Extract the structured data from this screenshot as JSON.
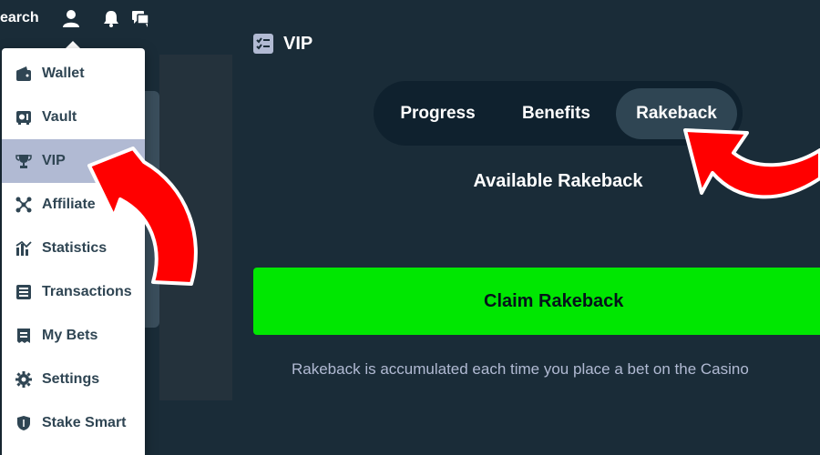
{
  "topbar": {
    "search_label": "earch",
    "icons": [
      "user-icon",
      "bell-icon",
      "chat-icon"
    ]
  },
  "menu": {
    "items": [
      {
        "label": "Wallet",
        "icon": "wallet-icon",
        "active": false
      },
      {
        "label": "Vault",
        "icon": "vault-icon",
        "active": false
      },
      {
        "label": "VIP",
        "icon": "trophy-icon",
        "active": true
      },
      {
        "label": "Affiliate",
        "icon": "affiliate-icon",
        "active": false
      },
      {
        "label": "Statistics",
        "icon": "statistics-icon",
        "active": false
      },
      {
        "label": "Transactions",
        "icon": "transactions-icon",
        "active": false
      },
      {
        "label": "My Bets",
        "icon": "bets-icon",
        "active": false
      },
      {
        "label": "Settings",
        "icon": "gear-icon",
        "active": false
      },
      {
        "label": "Stake Smart",
        "icon": "shield-icon",
        "active": false
      }
    ]
  },
  "page": {
    "title": "VIP",
    "tabs": [
      {
        "label": "Progress",
        "active": false
      },
      {
        "label": "Benefits",
        "active": false
      },
      {
        "label": "Rakeback",
        "active": true
      }
    ],
    "available_label": "Available Rakeback",
    "claim_label": "Claim Rakeback",
    "note": "Rakeback is accumulated each time you place a bet on the Casino"
  },
  "colors": {
    "background": "#0f212e",
    "panel": "#1a2c38",
    "accent_green": "#00e701",
    "active_tab": "#2f4553",
    "menu_active": "#b1bad3",
    "arrow_red": "#ff0000"
  }
}
